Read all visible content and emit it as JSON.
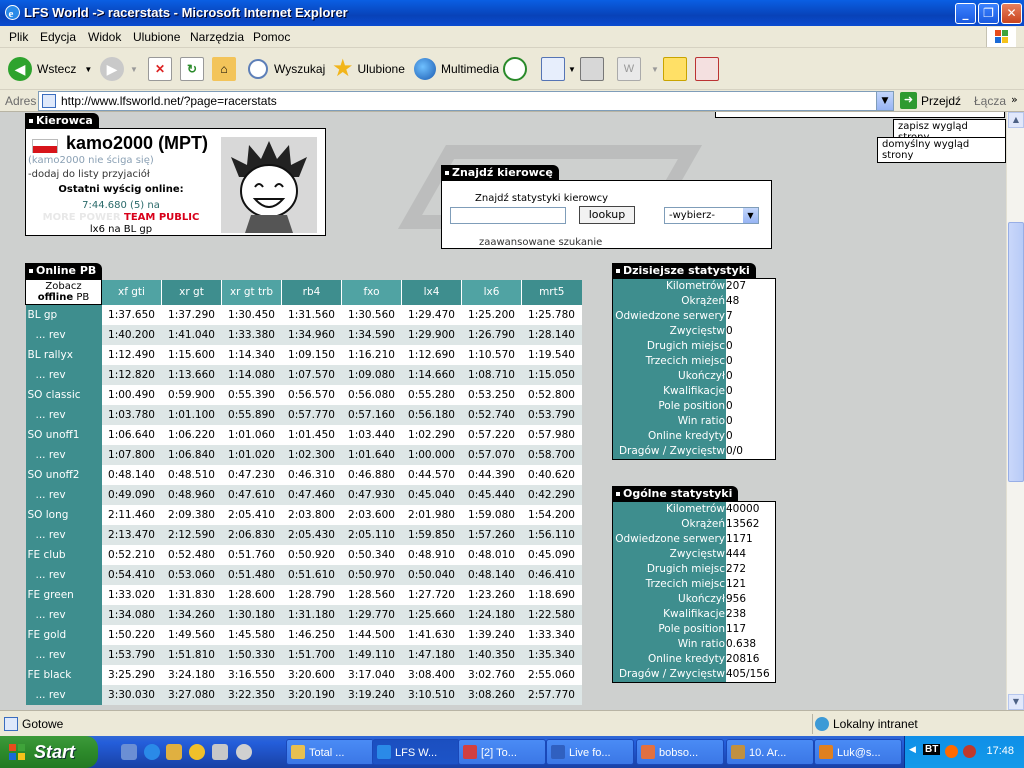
{
  "window": {
    "title": "LFS World -> racerstats - Microsoft Internet Explorer",
    "minimize": "_",
    "maximize": "❐",
    "close": "✕"
  },
  "menu": [
    "Plik",
    "Edycja",
    "Widok",
    "Ulubione",
    "Narzędzia",
    "Pomoc"
  ],
  "toolbar": {
    "back": "Wstecz",
    "search": "Wyszukaj",
    "favorites": "Ulubione",
    "multimedia": "Multimedia"
  },
  "address": {
    "label": "Adres",
    "url": "http://www.lfsworld.net/?page=racerstats",
    "go": "Przejdź",
    "links": "Łącza"
  },
  "layout_links": {
    "save": "zapisz wygląd strony",
    "default": "domyślny wygląd strony"
  },
  "driver": {
    "section": "Kierowca",
    "name": "kamo2000 (MPT)",
    "status": "(kamo2000 nie ściga się)",
    "add_friend": "-dodaj do listy przyjaciół",
    "last_race_label": "Ostatni wyścig online:",
    "last_race_time": "7:44.680 (5) na",
    "team_part1": "MORE POWER",
    "team_part2": "TEAM PUBLIC",
    "last_race_track": "lx6 na BL gp"
  },
  "find": {
    "section": "Znajdź kierowcę",
    "label": "Znajdź statystyki kierowcy",
    "input_value": "",
    "button": "lookup",
    "select": "-wybierz-",
    "advanced": "zaawansowane szukanie"
  },
  "pb": {
    "section": "Online PB",
    "corner_line1": "Zobacz",
    "corner_line2": "offline",
    "corner_line3": "PB",
    "cars": [
      "xf gti",
      "xr gt",
      "xr gt trb",
      "rb4",
      "fxo",
      "lx4",
      "lx6",
      "mrt5"
    ],
    "rows": [
      {
        "name": "BL gp",
        "times": [
          "1:37.650",
          "1:37.290",
          "1:30.450",
          "1:31.560",
          "1:30.560",
          "1:29.470",
          "1:25.200",
          "1:25.780"
        ]
      },
      {
        "name": "... rev",
        "times": [
          "1:40.200",
          "1:41.040",
          "1:33.380",
          "1:34.960",
          "1:34.590",
          "1:29.900",
          "1:26.790",
          "1:28.140"
        ]
      },
      {
        "name": "BL rallyx",
        "times": [
          "1:12.490",
          "1:15.600",
          "1:14.340",
          "1:09.150",
          "1:16.210",
          "1:12.690",
          "1:10.570",
          "1:19.540"
        ]
      },
      {
        "name": "... rev",
        "times": [
          "1:12.820",
          "1:13.660",
          "1:14.080",
          "1:07.570",
          "1:09.080",
          "1:14.660",
          "1:08.710",
          "1:15.050"
        ]
      },
      {
        "name": "SO classic",
        "times": [
          "1:00.490",
          "0:59.900",
          "0:55.390",
          "0:56.570",
          "0:56.080",
          "0:55.280",
          "0:53.250",
          "0:52.800"
        ]
      },
      {
        "name": "... rev",
        "times": [
          "1:03.780",
          "1:01.100",
          "0:55.890",
          "0:57.770",
          "0:57.160",
          "0:56.180",
          "0:52.740",
          "0:53.790"
        ]
      },
      {
        "name": "SO unoff1",
        "times": [
          "1:06.640",
          "1:06.220",
          "1:01.060",
          "1:01.450",
          "1:03.440",
          "1:02.290",
          "0:57.220",
          "0:57.980"
        ]
      },
      {
        "name": "... rev",
        "times": [
          "1:07.800",
          "1:06.840",
          "1:01.020",
          "1:02.300",
          "1:01.640",
          "1:00.000",
          "0:57.070",
          "0:58.700"
        ]
      },
      {
        "name": "SO unoff2",
        "times": [
          "0:48.140",
          "0:48.510",
          "0:47.230",
          "0:46.310",
          "0:46.880",
          "0:44.570",
          "0:44.390",
          "0:40.620"
        ]
      },
      {
        "name": "... rev",
        "times": [
          "0:49.090",
          "0:48.960",
          "0:47.610",
          "0:47.460",
          "0:47.930",
          "0:45.040",
          "0:45.440",
          "0:42.290"
        ]
      },
      {
        "name": "SO long",
        "times": [
          "2:11.460",
          "2:09.380",
          "2:05.410",
          "2:03.800",
          "2:03.600",
          "2:01.980",
          "1:59.080",
          "1:54.200"
        ]
      },
      {
        "name": "... rev",
        "times": [
          "2:13.470",
          "2:12.590",
          "2:06.830",
          "2:05.430",
          "2:05.110",
          "1:59.850",
          "1:57.260",
          "1:56.110"
        ]
      },
      {
        "name": "FE club",
        "times": [
          "0:52.210",
          "0:52.480",
          "0:51.760",
          "0:50.920",
          "0:50.340",
          "0:48.910",
          "0:48.010",
          "0:45.090"
        ]
      },
      {
        "name": "... rev",
        "times": [
          "0:54.410",
          "0:53.060",
          "0:51.480",
          "0:51.610",
          "0:50.970",
          "0:50.040",
          "0:48.140",
          "0:46.410"
        ]
      },
      {
        "name": "FE green",
        "times": [
          "1:33.020",
          "1:31.830",
          "1:28.600",
          "1:28.790",
          "1:28.560",
          "1:27.720",
          "1:23.260",
          "1:18.690"
        ]
      },
      {
        "name": "... rev",
        "times": [
          "1:34.080",
          "1:34.260",
          "1:30.180",
          "1:31.180",
          "1:29.770",
          "1:25.660",
          "1:24.180",
          "1:22.580"
        ]
      },
      {
        "name": "FE gold",
        "times": [
          "1:50.220",
          "1:49.560",
          "1:45.580",
          "1:46.250",
          "1:44.500",
          "1:41.630",
          "1:39.240",
          "1:33.340"
        ]
      },
      {
        "name": "... rev",
        "times": [
          "1:53.790",
          "1:51.810",
          "1:50.330",
          "1:51.700",
          "1:49.110",
          "1:47.180",
          "1:40.350",
          "1:35.340"
        ]
      },
      {
        "name": "FE black",
        "times": [
          "3:25.290",
          "3:24.180",
          "3:16.550",
          "3:20.600",
          "3:17.040",
          "3:08.400",
          "3:02.760",
          "2:55.060"
        ]
      },
      {
        "name": "... rev",
        "times": [
          "3:30.030",
          "3:27.080",
          "3:22.350",
          "3:20.190",
          "3:19.240",
          "3:10.510",
          "3:08.260",
          "2:57.770"
        ]
      }
    ]
  },
  "today_stats": {
    "section": "Dzisiejsze statystyki",
    "rows": [
      {
        "k": "Kilometrów",
        "v": "207"
      },
      {
        "k": "Okrążeń",
        "v": "48"
      },
      {
        "k": "Odwiedzone serwery",
        "v": "7"
      },
      {
        "k": "Zwycięstw",
        "v": "0"
      },
      {
        "k": "Drugich miejsc",
        "v": "0"
      },
      {
        "k": "Trzecich miejsc",
        "v": "0"
      },
      {
        "k": "Ukończył",
        "v": "0"
      },
      {
        "k": "Kwalifikacje",
        "v": "0"
      },
      {
        "k": "Pole position",
        "v": "0"
      },
      {
        "k": "Win ratio",
        "v": "0"
      },
      {
        "k": "Online kredyty",
        "v": "0"
      },
      {
        "k": "Dragów / Zwycięstw",
        "v": "0/0"
      }
    ]
  },
  "overall_stats": {
    "section": "Ogólne statystyki",
    "rows": [
      {
        "k": "Kilometrów",
        "v": "40000"
      },
      {
        "k": "Okrążeń",
        "v": "13562"
      },
      {
        "k": "Odwiedzone serwery",
        "v": "1171"
      },
      {
        "k": "Zwycięstw",
        "v": "444"
      },
      {
        "k": "Drugich miejsc",
        "v": "272"
      },
      {
        "k": "Trzecich miejsc",
        "v": "121"
      },
      {
        "k": "Ukończył",
        "v": "956"
      },
      {
        "k": "Kwalifikacje",
        "v": "238"
      },
      {
        "k": "Pole position",
        "v": "117"
      },
      {
        "k": "Win ratio",
        "v": "0.638"
      },
      {
        "k": "Online kredyty",
        "v": "20816"
      },
      {
        "k": "Dragów / Zwycięstw",
        "v": "405/156"
      }
    ]
  },
  "status": {
    "text": "Gotowe",
    "zone": "Lokalny intranet"
  },
  "taskbar": {
    "start": "Start",
    "tasks": [
      "Total ...",
      "LFS W...",
      "[2] To...",
      "Live fo...",
      "bobso...",
      "10. Ar...",
      "Luk@s..."
    ],
    "clock": "17:48",
    "tray_label": "BT"
  },
  "colors": {
    "teal_dark": "#3e8e8e",
    "teal_light": "#50a3a3",
    "xp_blue": "#0a4bd0",
    "start_green": "#2d8a2b"
  }
}
